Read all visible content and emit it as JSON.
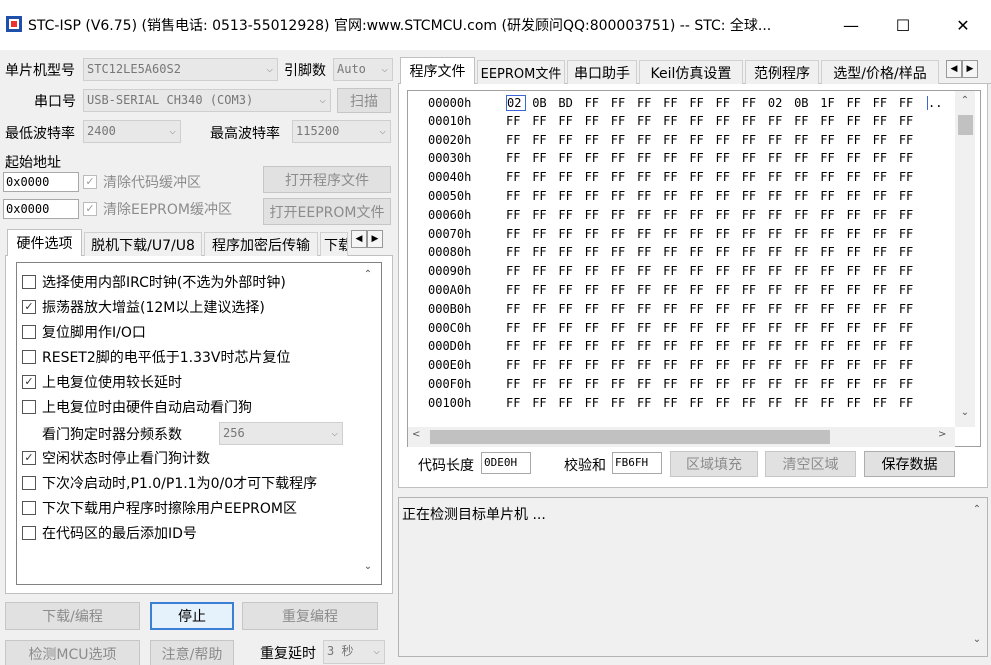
{
  "window": {
    "title": "STC-ISP (V6.75) (销售电话: 0513-55012928) 官网:www.STCMCU.com  (研发顾问QQ:800003751)  -- STC: 全球...",
    "minimize": "—",
    "maximize": "☐",
    "close": "✕"
  },
  "left": {
    "mcu_label": "单片机型号",
    "mcu_value": "STC12LE5A60S2",
    "pin_label": "引脚数",
    "pin_value": "Auto",
    "port_label": "串口号",
    "port_value": "USB-SERIAL CH340 (COM3)",
    "scan_button": "扫描",
    "min_baud_label": "最低波特率",
    "min_baud_value": "2400",
    "max_baud_label": "最高波特率",
    "max_baud_value": "115200",
    "start_addr_label": "起始地址",
    "code_addr": "0x0000",
    "clear_code_label": "清除代码缓冲区",
    "open_program_button": "打开程序文件",
    "eeprom_addr": "0x0000",
    "clear_eeprom_label": "清除EEPROM缓冲区",
    "open_eeprom_button": "打开EEPROM文件"
  },
  "left_tabs": [
    "硬件选项",
    "脱机下载/U7/U8",
    "程序加密后传输",
    "下载"
  ],
  "hardware_options": [
    {
      "label": "选择使用内部IRC时钟(不选为外部时钟)",
      "checked": false
    },
    {
      "label": "振荡器放大增益(12M以上建议选择)",
      "checked": true
    },
    {
      "label": "复位脚用作I/O口",
      "checked": false
    },
    {
      "label": "RESET2脚的电平低于1.33V时芯片复位",
      "checked": false
    },
    {
      "label": "上电复位使用较长延时",
      "checked": true
    },
    {
      "label": "上电复位时由硬件自动启动看门狗",
      "checked": false
    }
  ],
  "watchdog": {
    "label": "看门狗定时器分频系数",
    "value": "256"
  },
  "hardware_options_2": [
    {
      "label": "空闲状态时停止看门狗计数",
      "checked": true
    },
    {
      "label": "下次冷启动时,P1.0/P1.1为0/0才可下载程序",
      "checked": false
    },
    {
      "label": "下次下载用户程序时擦除用户EEPROM区",
      "checked": false
    },
    {
      "label": "在代码区的最后添加ID号",
      "checked": false
    }
  ],
  "bottom": {
    "download_button": "下载/编程",
    "stop_button": "停止",
    "reprogram_button": "重复编程",
    "detect_button": "检测MCU选项",
    "help_button": "注意/帮助",
    "delay_label": "重复延时",
    "delay_value": "3 秒"
  },
  "right_tabs": [
    "程序文件",
    "EEPROM文件",
    "串口助手",
    "Keil仿真设置",
    "范例程序",
    "选型/价格/样品"
  ],
  "hex": {
    "addresses": [
      "00000h",
      "00010h",
      "00020h",
      "00030h",
      "00040h",
      "00050h",
      "00060h",
      "00070h",
      "00080h",
      "00090h",
      "000A0h",
      "000B0h",
      "000C0h",
      "000D0h",
      "000E0h",
      "000F0h",
      "00100h"
    ],
    "first_row": [
      "02",
      "0B",
      "BD",
      "FF",
      "FF",
      "FF",
      "FF",
      "FF",
      "FF",
      "FF",
      "02",
      "0B",
      "1F",
      "FF",
      "FF"
    ],
    "fill_byte": "FF",
    "first_row_ascii": ".."
  },
  "code_info": {
    "length_label": "代码长度",
    "length_value": "0DE0H",
    "checksum_label": "校验和",
    "checksum_value": "FB6FH",
    "fill_button": "区域填充",
    "clear_button": "清空区域",
    "save_button": "保存数据"
  },
  "log": {
    "text": "正在检测目标单片机 ..."
  }
}
